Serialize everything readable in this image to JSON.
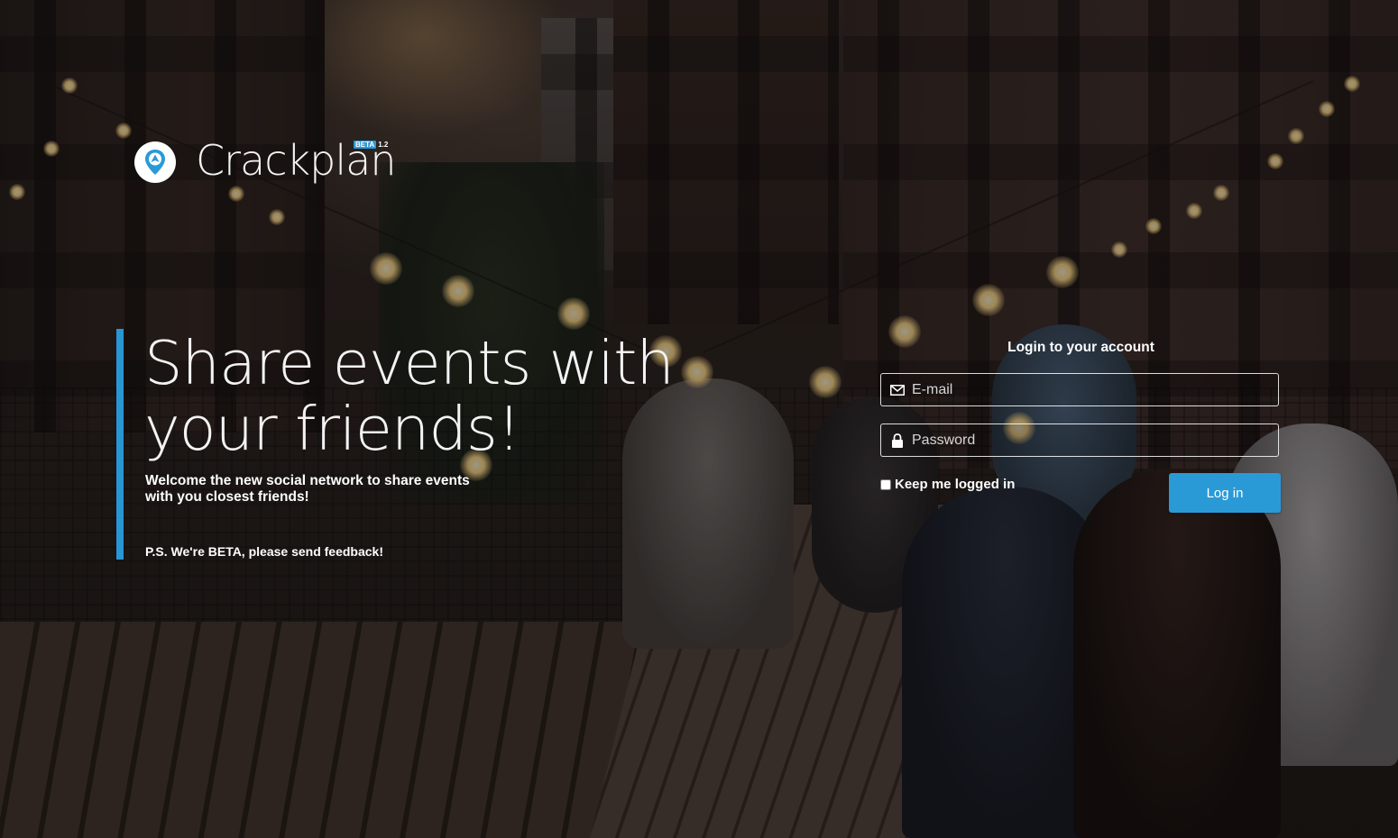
{
  "brand": {
    "name": "Crackplan",
    "beta_label": "BETA",
    "version": "1.2",
    "accent_color": "#2a9ad7"
  },
  "hero": {
    "title": "Share events with your friends!",
    "subtitle": "Welcome the new social network to share events with you closest friends!",
    "ps": "P.S. We're BETA, please send feedback!"
  },
  "login": {
    "title": "Login to your account",
    "email_placeholder": "E-mail",
    "email_icon": "envelope-icon",
    "password_placeholder": "Password",
    "password_icon": "lock-icon",
    "keep_logged_in_label": "Keep me logged in",
    "keep_logged_in_checked": false,
    "submit_label": "Log in"
  }
}
